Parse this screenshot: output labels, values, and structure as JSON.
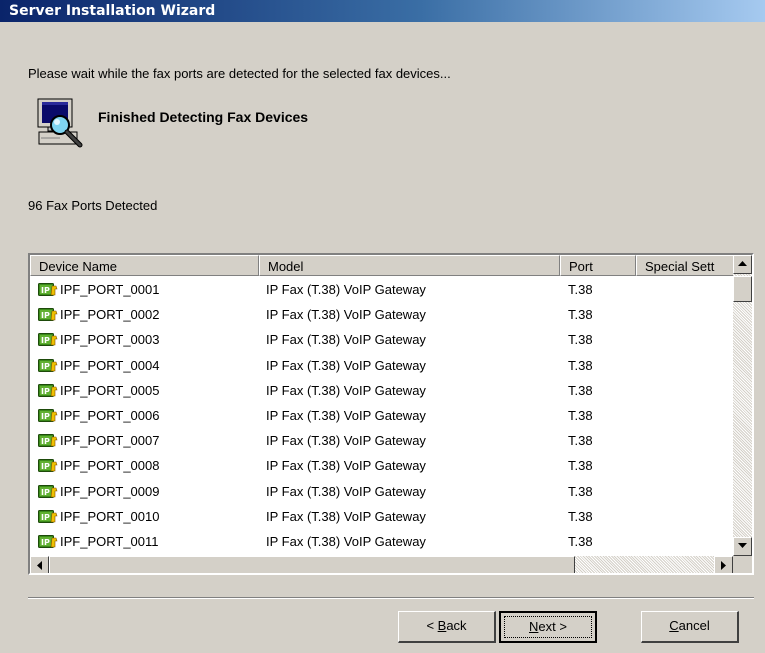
{
  "window": {
    "title": "Server Installation Wizard"
  },
  "instruction": "Please wait while the fax ports are detected for the selected fax devices...",
  "status": {
    "heading": "Finished Detecting Fax Devices",
    "icon": "computer-search-icon",
    "ports_detected": "96 Fax Ports Detected"
  },
  "list": {
    "columns": [
      "Device Name",
      "Model",
      "Port",
      "Special Sett"
    ],
    "rows": [
      {
        "name": "IPF_PORT_0001",
        "model": "IP Fax (T.38) VoIP Gateway",
        "port": "T.38"
      },
      {
        "name": "IPF_PORT_0002",
        "model": "IP Fax (T.38) VoIP Gateway",
        "port": "T.38"
      },
      {
        "name": "IPF_PORT_0003",
        "model": "IP Fax (T.38) VoIP Gateway",
        "port": "T.38"
      },
      {
        "name": "IPF_PORT_0004",
        "model": "IP Fax (T.38) VoIP Gateway",
        "port": "T.38"
      },
      {
        "name": "IPF_PORT_0005",
        "model": "IP Fax (T.38) VoIP Gateway",
        "port": "T.38"
      },
      {
        "name": "IPF_PORT_0006",
        "model": "IP Fax (T.38) VoIP Gateway",
        "port": "T.38"
      },
      {
        "name": "IPF_PORT_0007",
        "model": "IP Fax (T.38) VoIP Gateway",
        "port": "T.38"
      },
      {
        "name": "IPF_PORT_0008",
        "model": "IP Fax (T.38) VoIP Gateway",
        "port": "T.38"
      },
      {
        "name": "IPF_PORT_0009",
        "model": "IP Fax (T.38) VoIP Gateway",
        "port": "T.38"
      },
      {
        "name": "IPF_PORT_0010",
        "model": "IP Fax (T.38) VoIP Gateway",
        "port": "T.38"
      },
      {
        "name": "IPF_PORT_0011",
        "model": "IP Fax (T.38) VoIP Gateway",
        "port": "T.38"
      }
    ],
    "row_icon": "ip-fax-device-icon"
  },
  "buttons": {
    "back": {
      "pre": "< ",
      "key": "B",
      "rest": "ack"
    },
    "next": {
      "pre": "",
      "key": "N",
      "rest": "ext >"
    },
    "cancel": {
      "pre": "",
      "key": "C",
      "rest": "ancel"
    }
  },
  "colors": {
    "title_start": "#0a246a",
    "title_end": "#a6caf0",
    "face": "#d4d0c8",
    "icon_green": "#3a8a1a"
  }
}
